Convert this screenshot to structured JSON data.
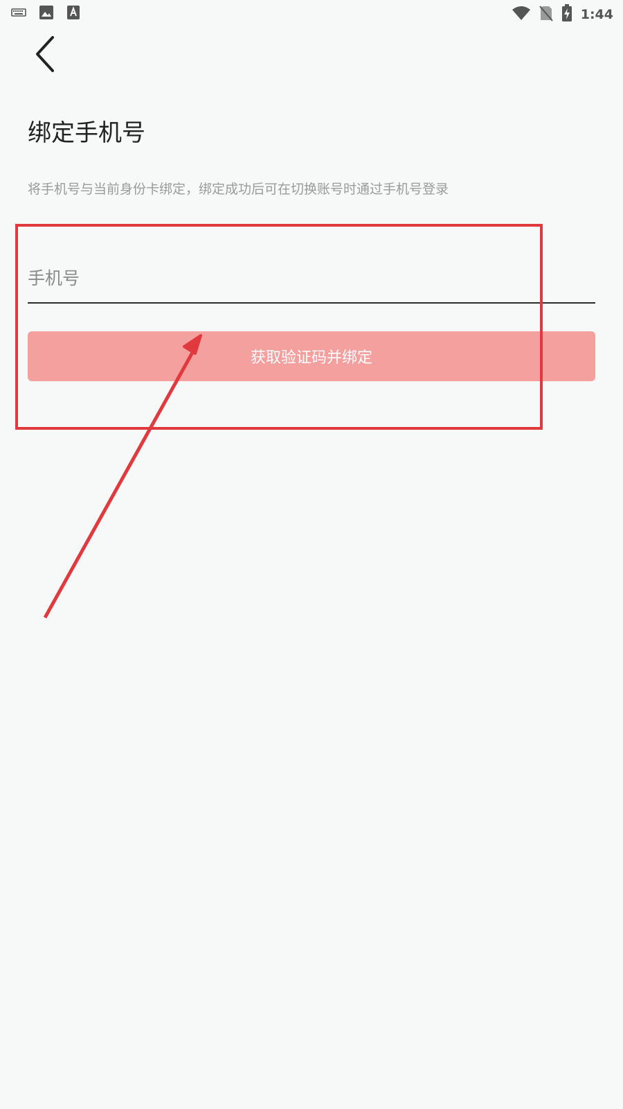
{
  "status_bar": {
    "time": "1:44",
    "left_icons": [
      "keyboard-icon",
      "image-icon",
      "font-icon"
    ],
    "right_icons": [
      "wifi-icon",
      "no-sim-icon",
      "battery-charging-icon"
    ]
  },
  "header": {
    "back_icon": "chevron-left-icon"
  },
  "main": {
    "title": "绑定手机号",
    "subtitle": "将手机号与当前身份卡绑定，绑定成功后可在切换账号时通过手机号登录",
    "phone_input": {
      "placeholder": "手机号",
      "value": ""
    },
    "bind_button_label": "获取验证码并绑定"
  },
  "colors": {
    "background": "#f7f8f8",
    "button": "#f4a09f",
    "annotation": "#e0393e"
  }
}
